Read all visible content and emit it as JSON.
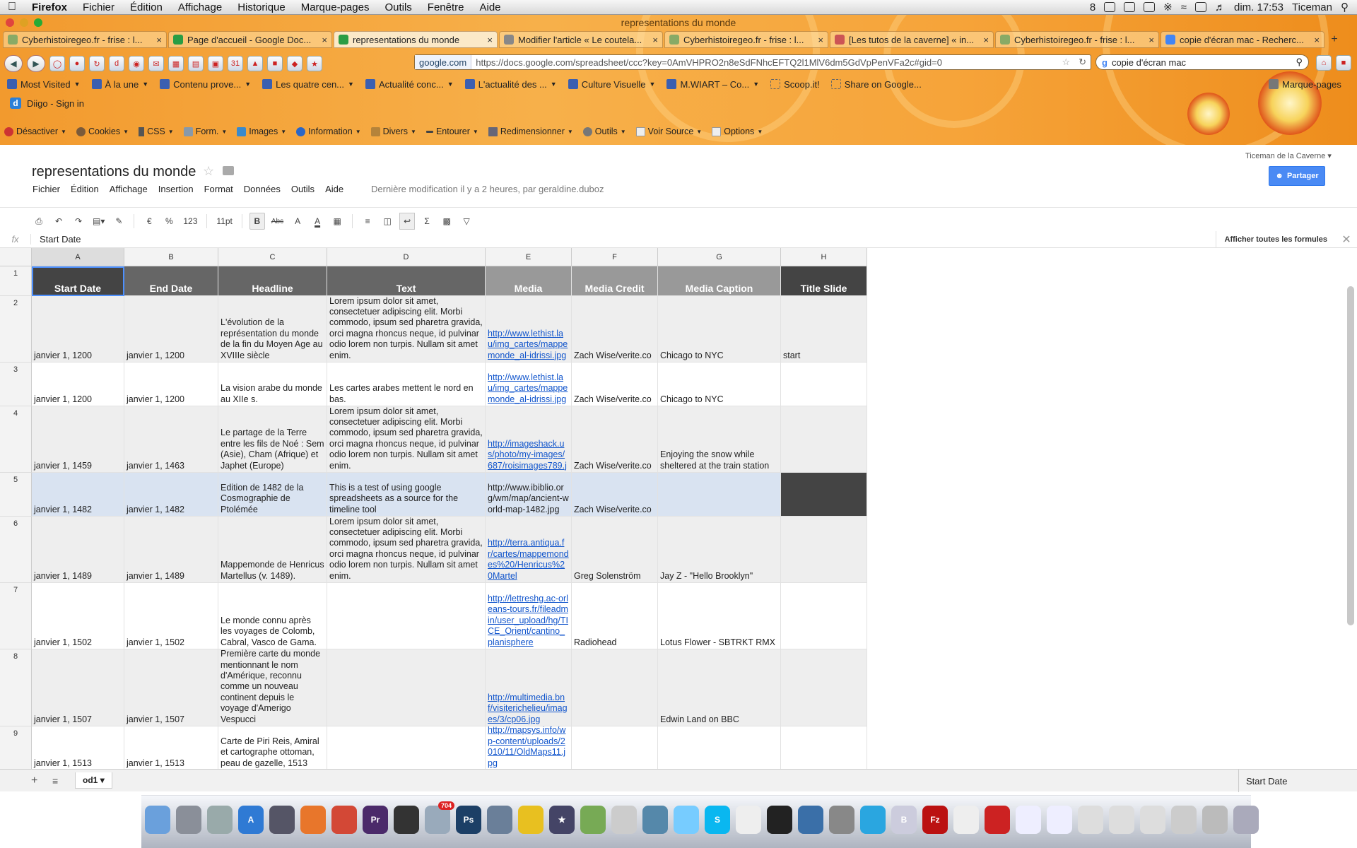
{
  "menubar": {
    "app": "Firefox",
    "items": [
      "Fichier",
      "Édition",
      "Affichage",
      "Historique",
      "Marque-pages",
      "Outils",
      "Fenêtre",
      "Aide"
    ],
    "right_num": "8",
    "clock": "dim. 17:53",
    "user": "Ticeman"
  },
  "window": {
    "title": "representations du monde"
  },
  "tabs": [
    {
      "label": "Cyberhistoiregeo.fr - frise : l...",
      "active": false
    },
    {
      "label": "Page d'accueil - Google Doc...",
      "active": false
    },
    {
      "label": "representations du monde",
      "active": true
    },
    {
      "label": "Modifier l'article « Le coutela...",
      "active": false
    },
    {
      "label": "Cyberhistoiregeo.fr - frise : l...",
      "active": false
    },
    {
      "label": "[Les tutos de la caverne] « in...",
      "active": false
    },
    {
      "label": "Cyberhistoiregeo.fr - frise : l...",
      "active": false
    },
    {
      "label": "copie d'écran mac - Recherc...",
      "active": false
    }
  ],
  "urlbar": {
    "domain": "google.com",
    "url": "https://docs.google.com/spreadsheet/ccc?key=0AmVHPRO2n8eSdFNhcEFTQ2l1MlV6dm5GdVpPenVFa2c#gid=0"
  },
  "searchbar": {
    "value": "copie d'écran mac"
  },
  "bookmarks": [
    "Most Visited",
    "À la une",
    "Contenu prove...",
    "Les quatre cen...",
    "Actualité conc...",
    "L'actualité des ...",
    "Culture Visuelle",
    "M.WIART – Co...",
    "Scoop.it!",
    "Share on Google..."
  ],
  "bookmarks_right": "Marque-pages",
  "diigo": {
    "label": "Diigo - Sign in"
  },
  "webdev": [
    "Désactiver",
    "Cookies",
    "CSS",
    "Form.",
    "Images",
    "Information",
    "Divers",
    "Entourer",
    "Redimensionner",
    "Outils",
    "Voir Source",
    "Options"
  ],
  "docs": {
    "title": "representations du monde",
    "user": "Ticeman de la Caverne",
    "share": "Partager",
    "menu": [
      "Fichier",
      "Édition",
      "Affichage",
      "Insertion",
      "Format",
      "Données",
      "Outils",
      "Aide"
    ],
    "last_modified": "Dernière modification il y a 2 heures, par geraldine.duboz",
    "toolbar": {
      "currency": "€",
      "percent": "%",
      "numfmt": "123",
      "font_size": "11pt",
      "bold": "B",
      "strike": "Abc",
      "text_color": "A",
      "sum": "Σ"
    },
    "formula": {
      "fx": "fx",
      "value": "Start Date",
      "show_all": "Afficher toutes les formules"
    },
    "sheet": {
      "name": "od1",
      "summary": "Start Date"
    }
  },
  "grid": {
    "col_letters": [
      "A",
      "B",
      "C",
      "D",
      "E",
      "F",
      "G",
      "H"
    ],
    "headers": [
      "Start Date",
      "End Date",
      "Headline",
      "Text",
      "Media",
      "Media Credit",
      "Media Caption",
      "Title Slide"
    ],
    "header_colors": [
      "#444444",
      "#666666",
      "#666666",
      "#666666",
      "#999999",
      "#999999",
      "#999999",
      "#444444"
    ],
    "row_numbers": [
      "1",
      "2",
      "3",
      "4",
      "5",
      "6",
      "7",
      "8",
      "9"
    ],
    "rows": [
      [
        "janvier 1, 1200",
        "janvier 1, 1200",
        "L'évolution de la représentation du monde de la fin du Moyen Age au XVIIIe siècle",
        "Lorem ipsum dolor sit amet, consectetuer adipiscing elit. Morbi commodo, ipsum sed pharetra gravida, orci magna rhoncus neque, id pulvinar odio lorem non turpis. Nullam sit amet enim.",
        "http://www.lethist.lau/img_cartes/mappemonde_al-idrissi.jpg",
        "Zach Wise/verite.co",
        "Chicago to NYC",
        "start"
      ],
      [
        "janvier 1, 1200",
        "janvier 1, 1200",
        "La vision arabe du monde au XIIe s.",
        "Les cartes arabes mettent le nord en bas.",
        "http://www.lethist.lau/img_cartes/mappemonde_al-idrissi.jpg",
        "Zach Wise/verite.co",
        "Chicago to NYC",
        ""
      ],
      [
        "janvier 1, 1459",
        "janvier 1, 1463",
        "Le partage de la Terre entre les fils de Noé : Sem (Asie), Cham (Afrique) et Japhet (Europe)",
        "Lorem ipsum dolor sit amet, consectetuer adipiscing elit. Morbi commodo, ipsum sed pharetra gravida, orci magna rhoncus neque, id pulvinar odio lorem non turpis. Nullam sit amet enim.",
        "http://imageshack.us/photo/my-images/687/roisimages789.j",
        "Zach Wise/verite.co",
        "Enjoying the snow while sheltered at the train station",
        ""
      ],
      [
        "janvier 1, 1482",
        "janvier 1, 1482",
        "Edition de 1482 de la Cosmographie de Ptolémée",
        "This is a test of using google spreadsheets as a source for the timeline tool",
        "http://www.ibiblio.org/wm/map/ancient-world-map-1482.jpg",
        "Zach Wise/verite.co",
        "",
        ""
      ],
      [
        "janvier 1, 1489",
        "janvier 1, 1489",
        "Mappemonde de Henricus Martellus (v. 1489).",
        "Lorem ipsum dolor sit amet, consectetuer adipiscing elit. Morbi commodo, ipsum sed pharetra gravida, orci magna rhoncus neque, id pulvinar odio lorem non turpis. Nullam sit amet enim.",
        "http://terra.antiqua.fr/cartes/mappemondes%20/Henricus%20Martel",
        "Greg Solenström",
        "Jay Z - \"Hello Brooklyn\"",
        ""
      ],
      [
        "janvier 1, 1502",
        "janvier 1, 1502",
        "Le monde connu après les voyages de Colomb, Cabral, Vasco de Gama.",
        "",
        "http://lettreshg.ac-orleans-tours.fr/fileadmin/user_upload/hg/TICE_Orient/cantino_planisphere",
        "Radiohead",
        "Lotus Flower - SBTRKT RMX",
        ""
      ],
      [
        "janvier 1, 1507",
        "janvier 1, 1507",
        "Première carte du monde mentionnant le nom d'Amérique, reconnu comme un nouveau continent depuis le voyage d'Amerigo Vespucci",
        "",
        "http://multimedia.bnf/visiterichelieu/images/3/cp06.jpg",
        "",
        "Edwin Land on BBC",
        ""
      ],
      [
        "janvier 1, 1513",
        "janvier 1, 1513",
        "Carte de Piri Reis, Amiral et cartographe ottoman, peau de gazelle, 1513",
        "",
        "http://mapsys.info/wp-content/uploads/2010/11/OldMaps11.jpg",
        "",
        "",
        ""
      ]
    ]
  },
  "dock_badge": "704"
}
